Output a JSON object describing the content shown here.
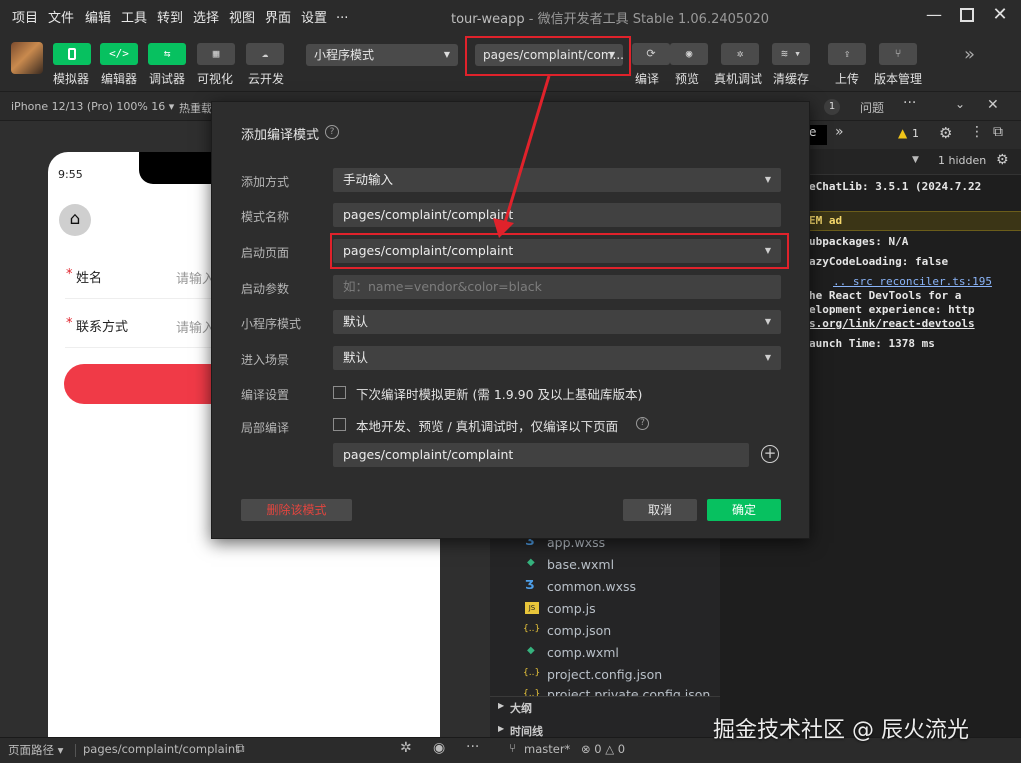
{
  "menu": [
    "项目",
    "文件",
    "编辑",
    "工具",
    "转到",
    "选择",
    "视图",
    "界面",
    "设置",
    "..."
  ],
  "window": {
    "title_app": "tour-weapp",
    "title_rest": " - 微信开发者工具 Stable 1.06.2405020"
  },
  "toolbar": {
    "simulator": "模拟器",
    "editor": "编辑器",
    "debugger": "调试器",
    "visual": "可视化",
    "cloud": "云开发",
    "mode_select": "小程序模式",
    "compile_select": "pages/complaint/com...",
    "compile": "编译",
    "preview": "预览",
    "real_debug": "真机调试",
    "clear_cache": "清缓存",
    "upload": "上传",
    "version": "版本管理",
    "sim_icon": "</>",
    "code_icon": "</>"
  },
  "subbar": {
    "device": "iPhone 12/13 (Pro) 100% 16",
    "hot": "热重载",
    "issues": "问题",
    "issue_count": "1",
    "warn_count": "1",
    "hidden": "1 hidden",
    "tab_tail": "e"
  },
  "phone": {
    "time": "9:55",
    "name_label": "姓名",
    "name_ph": "请输入",
    "contact_label": "联系方式",
    "contact_ph": "请输入",
    "required": "*"
  },
  "dialog": {
    "title": "添加编译模式",
    "rows": {
      "add_method": {
        "label": "添加方式",
        "value": "手动输入"
      },
      "mode_name": {
        "label": "模式名称",
        "value": "pages/complaint/complaint"
      },
      "start_page": {
        "label": "启动页面",
        "value": "pages/complaint/complaint"
      },
      "start_params": {
        "label": "启动参数",
        "placeholder": "如：name=vendor&color=black"
      },
      "mini_mode": {
        "label": "小程序模式",
        "value": "默认"
      },
      "scene": {
        "label": "进入场景",
        "value": "默认"
      },
      "compile_setting": {
        "label": "编译设置",
        "text": "下次编译时模拟更新 (需 1.9.90 及以上基础库版本)"
      },
      "partial": {
        "label": "局部编译",
        "text": "本地开发、预览 / 真机调试时，仅编译以下页面",
        "value": "pages/complaint/complaint"
      }
    },
    "delete": "删除该模式",
    "cancel": "取消",
    "confirm": "确定"
  },
  "console": [
    "eChatLib: 3.5.1 (2024.7.22",
    "EM ad",
    "ubpackages: N/A",
    "azyCodeLoading: false",
    ".. src reconciler.ts:195",
    "he React DevTools for a",
    "elopment experience: http",
    "s.org/link/react-devtools",
    "aunch Time: 1378 ms"
  ],
  "files": [
    {
      "name": "app.wxss",
      "icon": "3",
      "color": "#4e9fe8"
    },
    {
      "name": "base.wxml",
      "icon": "◆",
      "color": "#36b37e"
    },
    {
      "name": "common.wxss",
      "icon": "3",
      "color": "#4e9fe8"
    },
    {
      "name": "comp.js",
      "icon": "JS",
      "color": "#e8c53a"
    },
    {
      "name": "comp.json",
      "icon": "{..}",
      "color": "#e8c53a"
    },
    {
      "name": "comp.wxml",
      "icon": "◆",
      "color": "#36b37e"
    },
    {
      "name": "project.config.json",
      "icon": "{..}",
      "color": "#e8c53a"
    },
    {
      "name": "project.private.config.json",
      "icon": "{..}",
      "color": "#e8c53a"
    }
  ],
  "panels": {
    "outline": "大纲",
    "timeline": "时间线"
  },
  "statusbar": {
    "path_label": "页面路径",
    "path": "pages/complaint/complaint",
    "branch": "master*",
    "errors": "0",
    "warnings": "0"
  },
  "watermark": "掘金技术社区 @ 辰火流光",
  "colors": {
    "accent": "#07c160",
    "highlight": "#e0222b",
    "phone_button": "#f03a47"
  }
}
